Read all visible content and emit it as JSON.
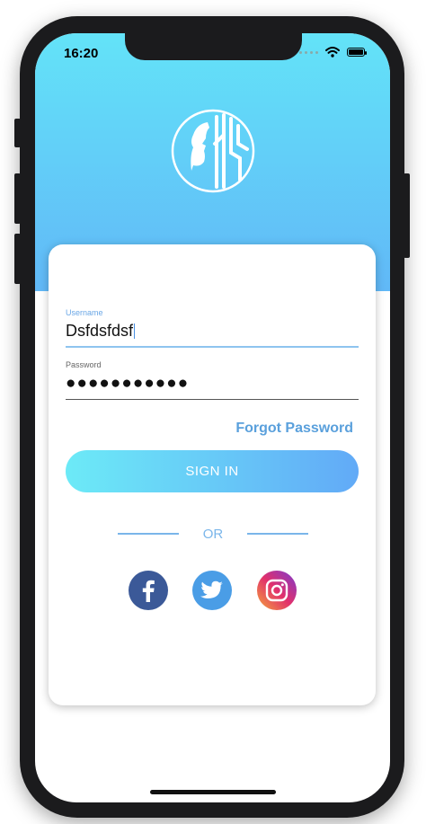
{
  "status_bar": {
    "time": "16:20"
  },
  "form": {
    "username_label": "Username",
    "username_value": "Dsfdsfdsf",
    "password_label": "Password",
    "password_value": "●●●●●●●●●●●",
    "forgot_label": "Forgot Password",
    "signin_label": "SIGN IN",
    "or_label": "OR"
  },
  "social": [
    {
      "icon": "facebook-icon",
      "color": "#3b5998"
    },
    {
      "icon": "twitter-icon",
      "color": "#4a9de6"
    },
    {
      "icon": "instagram-icon",
      "color": "#e1306c"
    }
  ],
  "colors": {
    "header_top": "#63e3f8",
    "header_bottom": "#61b8f7",
    "accent": "#5aa0dc"
  }
}
